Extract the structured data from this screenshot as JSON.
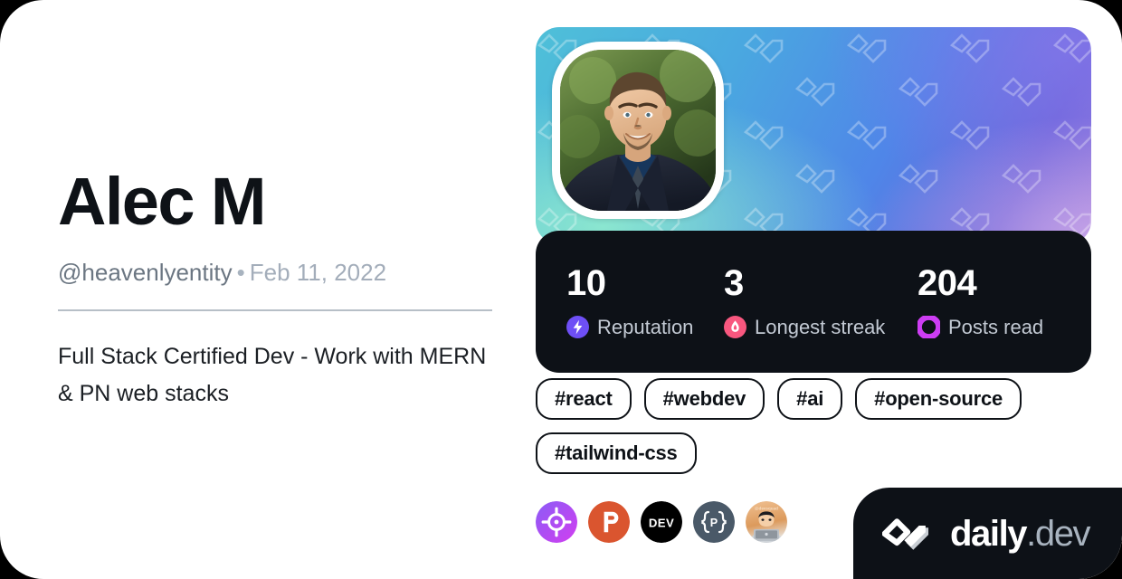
{
  "card": {
    "background_color": "#ffffff",
    "page_background_color": "#000000"
  },
  "profile": {
    "display_name": "Alec M",
    "handle": "@heavenlyentity",
    "separator": "•",
    "join_date": "Feb 11, 2022",
    "bio": "Full Stack Certified Dev - Work with MERN & PN web stacks",
    "avatar_alt": "profile-photo"
  },
  "stats": [
    {
      "id": "reputation",
      "value": "10",
      "label": "Reputation",
      "icon": "lightning-bolt-icon",
      "icon_color": "#6e4ff6"
    },
    {
      "id": "longest-streak",
      "value": "3",
      "label": "Longest streak",
      "icon": "flame-icon",
      "icon_color": "#f8577f"
    },
    {
      "id": "posts-read",
      "value": "204",
      "label": "Posts read",
      "icon": "ring-icon",
      "icon_color": "#cd3df3"
    }
  ],
  "tags": [
    {
      "label": "#react"
    },
    {
      "label": "#webdev"
    },
    {
      "label": "#ai"
    },
    {
      "label": "#open-source"
    },
    {
      "label": "#tailwind-css"
    }
  ],
  "sources": [
    {
      "id": "target-source",
      "name": "target-icon",
      "text": "",
      "bg": "#a843f0"
    },
    {
      "id": "producthunt-source",
      "name": "producthunt-icon",
      "text": "P",
      "bg": "#da552f"
    },
    {
      "id": "devto-source",
      "name": "devto-icon",
      "text": "DEV",
      "bg": "#000000"
    },
    {
      "id": "codebrace-source",
      "name": "code-braces-icon",
      "text": "P",
      "bg": "#4a5968"
    },
    {
      "id": "avatar-source",
      "name": "user-avatar-icon",
      "text": "",
      "bg": "#e0a56a"
    }
  ],
  "branding": {
    "logo_mark": "daily-dev-logo-icon",
    "name_primary": "daily",
    "name_secondary": ".dev",
    "badge_color": "#0d1117"
  }
}
